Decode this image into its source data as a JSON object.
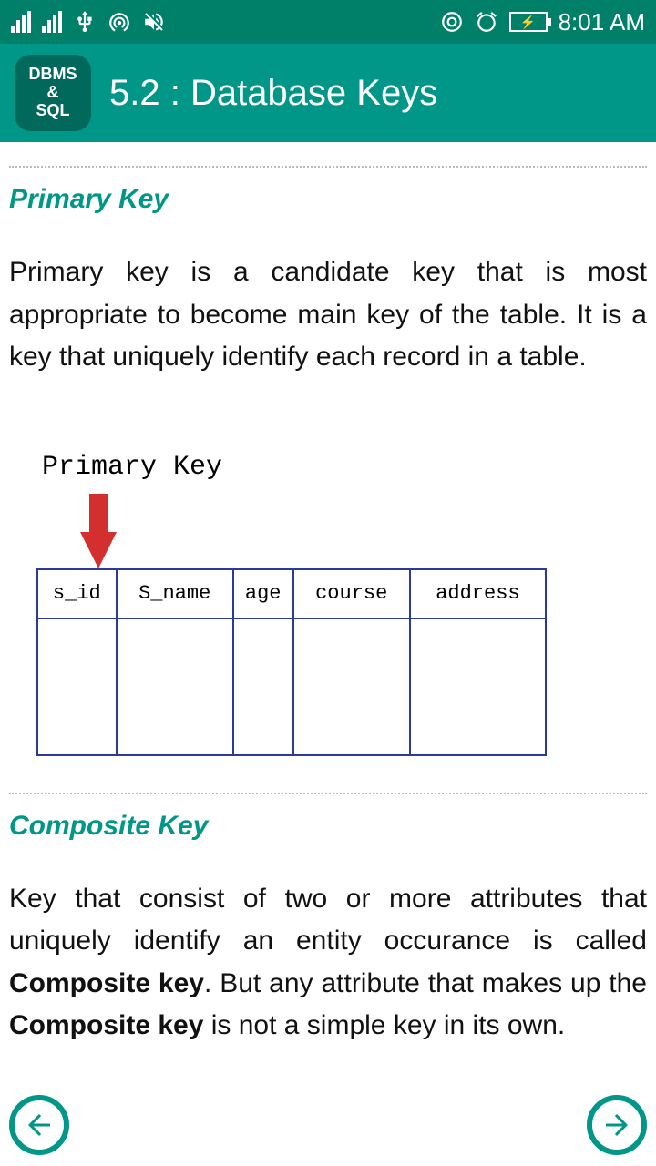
{
  "status": {
    "time": "8:01 AM"
  },
  "app": {
    "icon_line1": "DBMS",
    "icon_line2": "&",
    "icon_line3": "SQL",
    "title": "5.2 : Database Keys"
  },
  "section1": {
    "heading": "Primary Key",
    "paragraph": "Primary key is a candidate key that is most appropriate to become main key of the table. It is a key that uniquely identify each record in a table."
  },
  "diagram": {
    "label": "Primary Key",
    "cols": [
      "s_id",
      "S_name",
      "age",
      "course",
      "address"
    ]
  },
  "section2": {
    "heading": "Composite Key",
    "p_part1": "Key that consist of two or more attributes that uniquely identify an entity occurance is called ",
    "p_bold1": "Composite key",
    "p_part2": ". But any attribute that makes up the ",
    "p_bold2": "Composite key",
    "p_part3": " is not a simple key in its own."
  }
}
